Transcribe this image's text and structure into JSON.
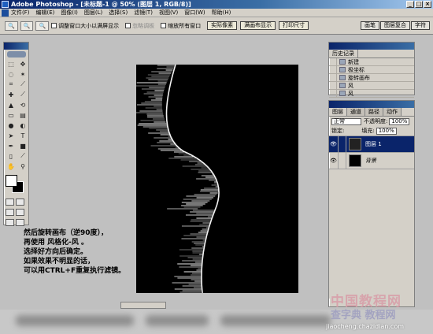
{
  "window": {
    "title": "Adobe Photoshop - [未标题-1 @ 50% (图层 1, RGB/8)]",
    "controls": [
      "_",
      "□",
      "×"
    ]
  },
  "menu": [
    "文件(F)",
    "编辑(E)",
    "图像(I)",
    "图层(L)",
    "选择(S)",
    "滤镜(T)",
    "视图(V)",
    "窗口(W)",
    "帮助(H)"
  ],
  "options": {
    "zoom_in": "🔍",
    "zoom_out": "🔍",
    "resize_window": "调整窗口大小以满屏显示",
    "ignore_palettes": "忽略调板",
    "zoom_all": "缩放所有窗口",
    "actual_pixels": "实际像素",
    "fit_screen": "满画布显示",
    "print_size": "打印尺寸",
    "tabs": [
      "画笔",
      "图层复合",
      "字符"
    ]
  },
  "history": {
    "tabs": [
      "历史记录"
    ],
    "items": [
      "新建",
      "极坐标",
      "旋转画布",
      "风",
      "风",
      "风"
    ]
  },
  "layers": {
    "tabs": [
      "图层",
      "通道",
      "路径",
      "动作"
    ],
    "blend_mode": "正常",
    "opacity_label": "不透明度:",
    "opacity": "100%",
    "lock_label": "锁定:",
    "fill_label": "填充:",
    "fill": "100%",
    "items": [
      {
        "name": "图层 1",
        "active": true
      },
      {
        "name": "背景",
        "active": false
      }
    ]
  },
  "caption": [
    "然后旋转画布（逆90度），",
    "再使用 风格化-风 。",
    "选择好方向后确定。",
    "如果效果不明显的话，",
    "可以用CTRL+F重复执行滤镜。"
  ],
  "watermark": {
    "line1": "中国教程网",
    "line2": "查字典 教程网",
    "url": "jiaocheng.chazidian.com"
  },
  "colors": {
    "titlebar": "#0a246a",
    "workspace": "#c0c0c0",
    "canvas": "#000000",
    "selection": "#0a246a"
  },
  "icons": [
    "photoshop-logo-icon",
    "zoom-in-icon",
    "zoom-out-icon",
    "eye-icon",
    "brush-icon"
  ]
}
